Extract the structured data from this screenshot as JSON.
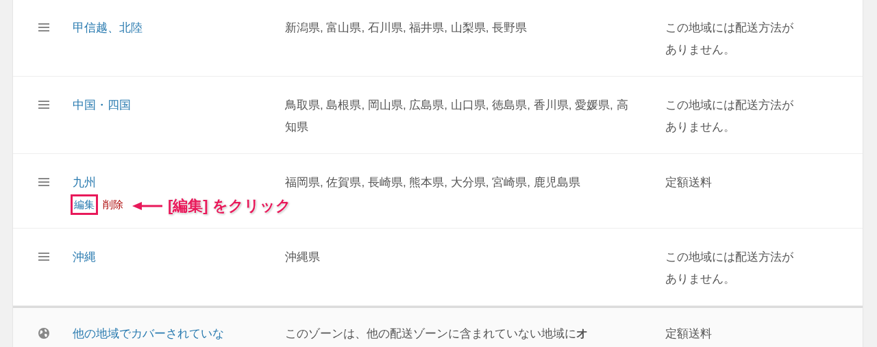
{
  "zones": [
    {
      "kind": "sortable",
      "name": "甲信越、北陸",
      "regions": "新潟県, 富山県, 石川県, 福井県, 山梨県, 長野県",
      "methods": "この地域には配送方法がありません。"
    },
    {
      "kind": "sortable",
      "name": "中国・四国",
      "regions": "鳥取県, 島根県, 岡山県, 広島県, 山口県, 徳島県, 香川県, 愛媛県, 高知県",
      "methods": "この地域には配送方法がありません。"
    },
    {
      "kind": "sortable",
      "name": "九州",
      "regions": "福岡県, 佐賀県, 長崎県, 熊本県, 大分県, 宮崎県, 鹿児島県",
      "methods": "定額送料",
      "actions": [
        {
          "kind": "edit",
          "label": "編集"
        },
        {
          "kind": "delete",
          "label": "削除"
        }
      ],
      "annotation": {
        "label": "[編集] をクリック"
      }
    },
    {
      "kind": "sortable",
      "name": "沖縄",
      "regions": "沖縄県",
      "methods": "この地域には配送方法がありません。"
    },
    {
      "kind": "rest_of_world",
      "name": "他の地域でカバーされていな",
      "regions": "このゾーンは、他の配送ゾーンに含まれていない地域に**オ**",
      "methods": "定額送料"
    }
  ]
}
